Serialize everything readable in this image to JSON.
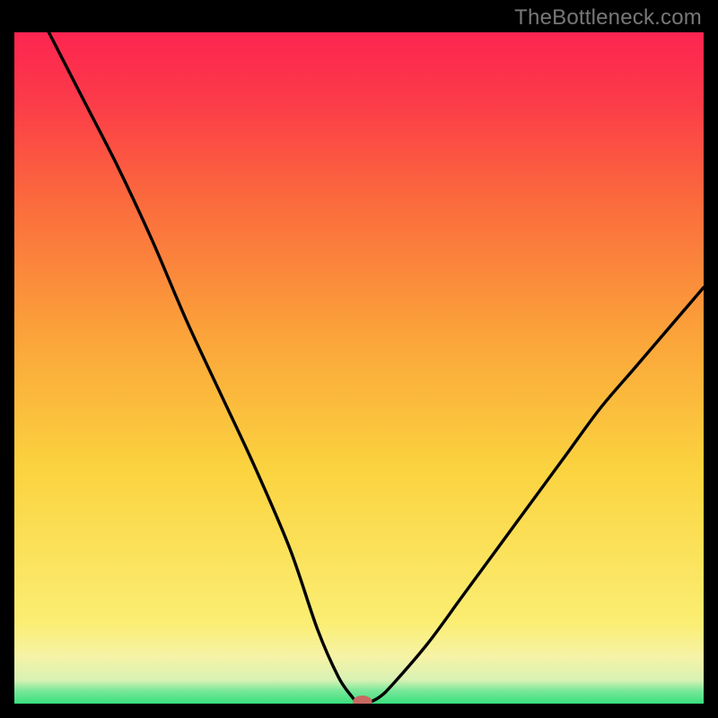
{
  "watermark": "TheBottleneck.com",
  "chart_data": {
    "type": "line",
    "title": "",
    "xlabel": "",
    "ylabel": "",
    "xlim": [
      0,
      100
    ],
    "ylim": [
      0,
      100
    ],
    "background_gradient": {
      "stops": [
        {
          "pos": 0.0,
          "color": "#39e07e"
        },
        {
          "pos": 0.02,
          "color": "#7de89a"
        },
        {
          "pos": 0.035,
          "color": "#d8f2b4"
        },
        {
          "pos": 0.07,
          "color": "#f6f3a6"
        },
        {
          "pos": 0.12,
          "color": "#fbee73"
        },
        {
          "pos": 0.35,
          "color": "#fbd33f"
        },
        {
          "pos": 0.55,
          "color": "#fba33a"
        },
        {
          "pos": 0.75,
          "color": "#fb6a3d"
        },
        {
          "pos": 0.9,
          "color": "#fc3a49"
        },
        {
          "pos": 1.0,
          "color": "#fd2550"
        }
      ]
    },
    "series": [
      {
        "name": "bottleneck-curve",
        "x": [
          5,
          10,
          15,
          20,
          25,
          30,
          35,
          40,
          44,
          47,
          49,
          50,
          51,
          53,
          55,
          60,
          65,
          70,
          75,
          80,
          85,
          90,
          95,
          100
        ],
        "y": [
          100,
          90,
          80,
          69,
          57,
          46,
          35,
          23,
          11,
          4,
          1,
          0,
          0,
          1,
          3,
          9,
          16,
          23,
          30,
          37,
          44,
          50,
          56,
          62
        ]
      }
    ],
    "marker": {
      "name": "optimal-point",
      "x": 50.5,
      "y": 0.3,
      "color": "#c86a63",
      "rx": 1.4,
      "ry": 0.9
    }
  }
}
